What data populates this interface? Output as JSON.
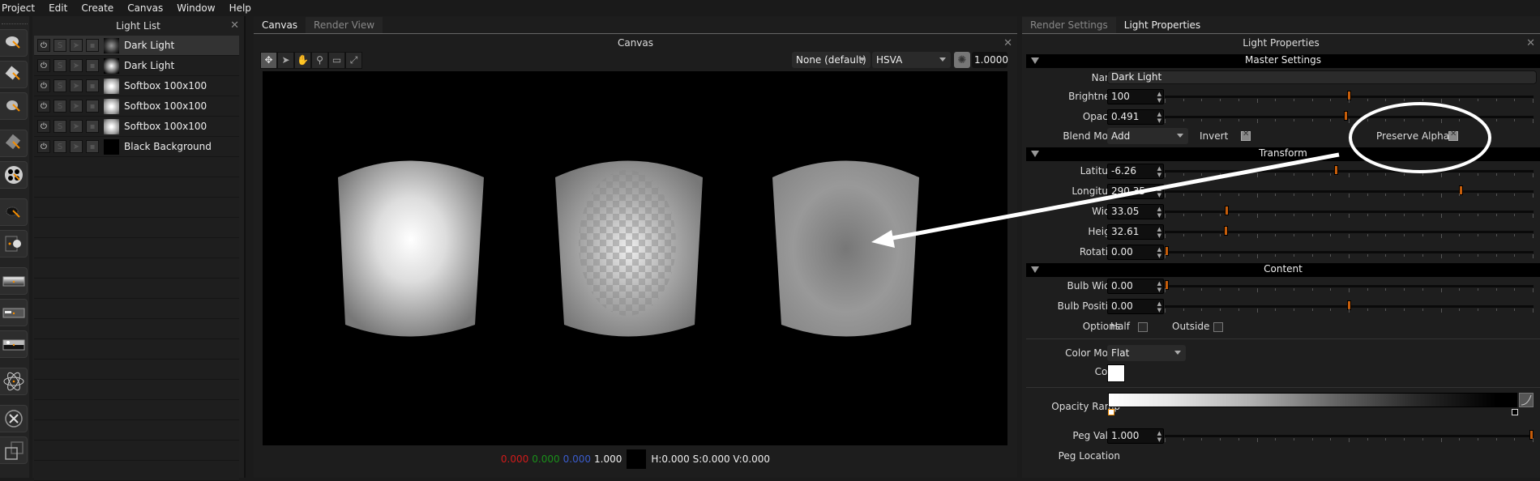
{
  "menubar": {
    "items": [
      "Project",
      "Edit",
      "Create",
      "Canvas",
      "Window",
      "Help"
    ]
  },
  "toolstrip": {
    "tools": [
      {
        "name": "sphere-light-tool"
      },
      {
        "name": "softbox-light-tool"
      },
      {
        "name": "round-light-tool"
      },
      {
        "name": "gradient-light-tool"
      },
      {
        "name": "pattern-light-tool"
      },
      {
        "name": "flag-tool"
      },
      {
        "name": "sun-tool"
      },
      {
        "name": "gradient-bg-tool"
      },
      {
        "name": "hdr-bg-tool"
      },
      {
        "name": "sky-bg-tool"
      },
      {
        "name": "atom-tool"
      },
      {
        "name": "delete-tool"
      },
      {
        "name": "duplicate-tool"
      }
    ]
  },
  "light_list": {
    "title": "Light List",
    "rows": [
      {
        "name": "Dark Light",
        "selected": true,
        "thumb": "dim"
      },
      {
        "name": "Dark Light",
        "selected": false,
        "thumb": "bright"
      },
      {
        "name": "Softbox 100x100",
        "selected": false,
        "thumb": "soft"
      },
      {
        "name": "Softbox 100x100",
        "selected": false,
        "thumb": "soft"
      },
      {
        "name": "Softbox 100x100",
        "selected": false,
        "thumb": "soft"
      },
      {
        "name": "Black Background",
        "selected": false,
        "thumb": "black"
      }
    ]
  },
  "canvas": {
    "tabs": [
      "Canvas",
      "Render View"
    ],
    "title": "Canvas",
    "tools": [
      "move",
      "select",
      "pan",
      "zoom",
      "zoom-region",
      "fit"
    ],
    "preset_dropdown": "None (default)",
    "color_mode_dropdown": "HSVA",
    "exposure_value": "1.0000",
    "status": {
      "r": "0.000",
      "g": "0.000",
      "b": "0.000",
      "a": "1.000",
      "hsv": "H:0.000 S:0.000 V:0.000"
    },
    "colors": {
      "r": "#d11a1a",
      "g": "#1a8f1a",
      "b": "#3a5ccc"
    }
  },
  "right_panel": {
    "tabs": [
      "Render Settings",
      "Light Properties"
    ],
    "title": "Light Properties",
    "sections": {
      "master": "Master Settings",
      "transform": "Transform",
      "content": "Content"
    },
    "name_label": "Name",
    "name_value": "Dark Light",
    "brightness": {
      "label": "Brightness",
      "value": "100",
      "fraction": 0.5
    },
    "opacity": {
      "label": "Opacity",
      "value": "0.491",
      "fraction": 0.491
    },
    "blend_mode": {
      "label": "Blend Mode",
      "value": "Add"
    },
    "invert": {
      "label": "Invert",
      "checked": true
    },
    "preserve_alpha": {
      "label": "Preserve Alpha",
      "checked": true
    },
    "latitude": {
      "label": "Latitude",
      "value": "-6.26",
      "fraction": 0.465
    },
    "longitude": {
      "label": "Longitude",
      "value": "290.35",
      "fraction": 0.806
    },
    "width": {
      "label": "Width",
      "value": "33.05",
      "fraction": 0.165
    },
    "height": {
      "label": "Height",
      "value": "32.61",
      "fraction": 0.163
    },
    "rotation": {
      "label": "Rotation",
      "value": "0.00",
      "fraction": 0.0
    },
    "bulb_width": {
      "label": "Bulb Width",
      "value": "0.00",
      "fraction": 0.0
    },
    "bulb_position": {
      "label": "Bulb Position",
      "value": "0.00",
      "fraction": 0.5
    },
    "options": {
      "label": "Options",
      "half": "Half",
      "outside": "Outside"
    },
    "color_mode": {
      "label": "Color Mode",
      "value": "Flat"
    },
    "color": {
      "label": "Color",
      "value": "#ffffff"
    },
    "opacity_ramp": {
      "label": "Opacity Ramp"
    },
    "peg_value": {
      "label": "Peg Value",
      "value": "1.000",
      "fraction": 1.0
    },
    "peg_location": {
      "label": "Peg Location"
    }
  }
}
